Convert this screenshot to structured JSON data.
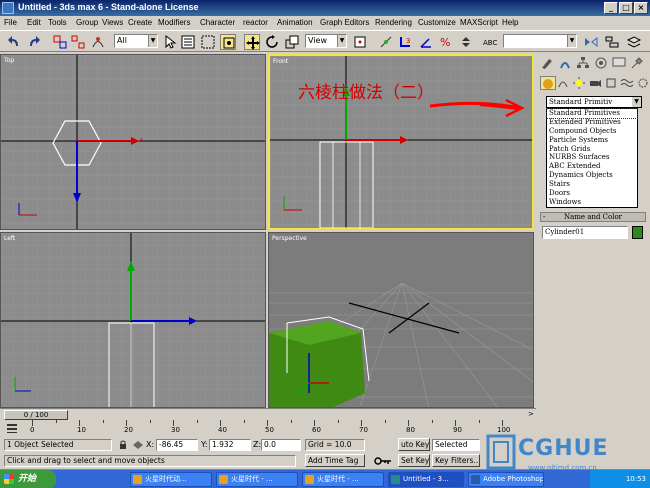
{
  "window": {
    "title": "Untitled - 3ds max 6 - Stand-alone License"
  },
  "menu": [
    "File",
    "Edit",
    "Tools",
    "Group",
    "Views",
    "Create",
    "Modifiers",
    "Character",
    "reactor",
    "Animation",
    "Graph Editors",
    "Rendering",
    "Customize",
    "MAXScript",
    "Help"
  ],
  "toolbar": {
    "selection_filter": "All",
    "ref_coord": "View"
  },
  "viewports": {
    "top": {
      "label": "Top"
    },
    "front": {
      "label": "Front",
      "annotation": "六棱柱做法（二）"
    },
    "left": {
      "label": "Left"
    },
    "perspective": {
      "label": "Perspective"
    }
  },
  "command_panel": {
    "category_selected": "Standard Primitiv",
    "categories": [
      "Standard Primitives",
      "Extended Primitives",
      "Compound Objects",
      "Particle Systems",
      "Patch Grids",
      "NURBS Surfaces",
      "ABC Extended",
      "Dynamics Objects",
      "Stairs",
      "Doors",
      "Windows"
    ],
    "rollout_title": "Name and Color",
    "object_name": "Cylinder01",
    "object_color": "#2a8a1a"
  },
  "timeline": {
    "slider": "0 / 100",
    "ticks": [
      "0",
      "10",
      "20",
      "30",
      "40",
      "50",
      "60",
      "70",
      "80",
      "90",
      "100"
    ]
  },
  "status": {
    "selection": "1 Object Selected",
    "x_label": "X:",
    "x_value": "-86.45",
    "y_label": "Y:",
    "y_value": "1.932",
    "z_label": "Z:",
    "z_value": "0.0",
    "grid": "Grid = 10.0",
    "auto_key": "uto Key",
    "selected": "Selected",
    "prompt": "Click and drag to select and move objects",
    "add_time_tag": "Add Time Tag",
    "set_key": "Set Key",
    "key_filters": "Key Filters..."
  },
  "taskbar": {
    "start": "开始",
    "tasks": [
      "火星时代动...",
      "火星时代 - ...",
      "火星时代 - ...",
      "Untitled - 3...",
      "Adobe Photoshop"
    ],
    "clock": "10:53"
  },
  "watermark": {
    "brand": "CGHUE",
    "site": "www.gltimd.com.cn"
  }
}
